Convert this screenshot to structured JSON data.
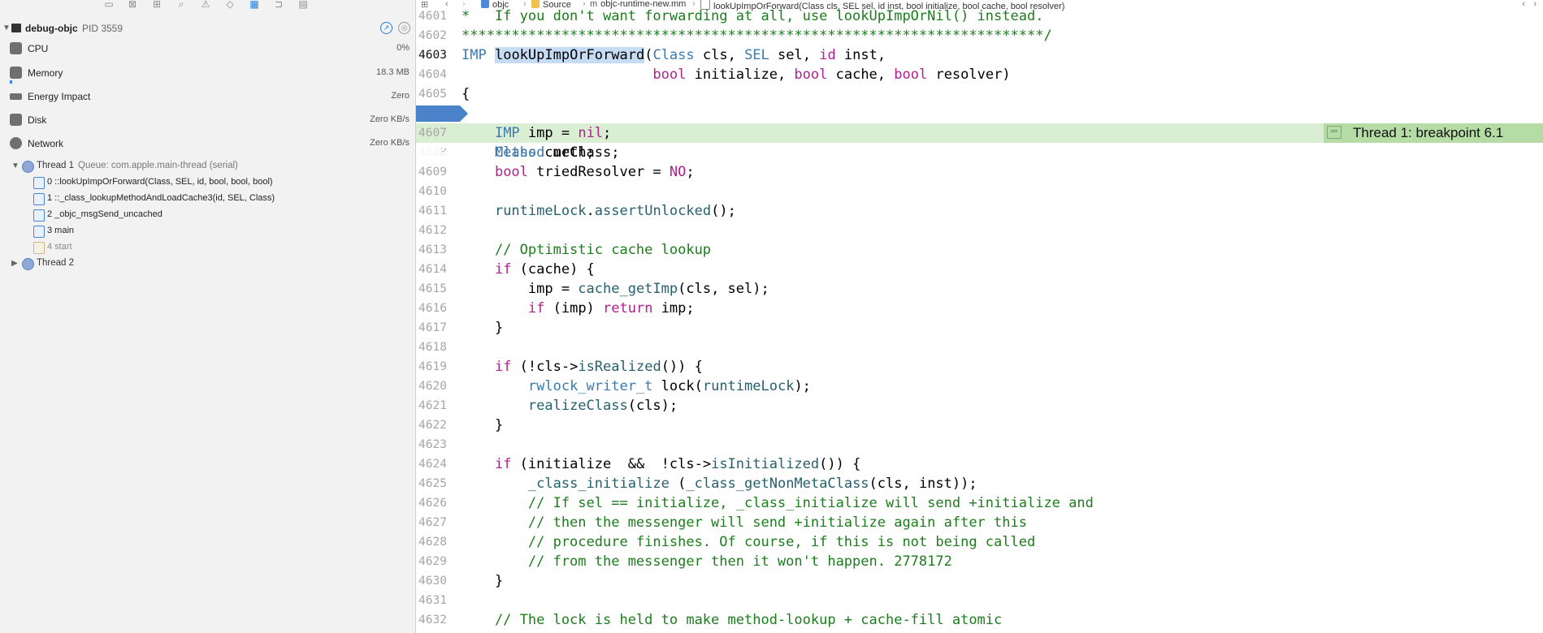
{
  "sidebar": {
    "process": {
      "name": "debug-objc",
      "pid": "PID 3559"
    },
    "gauges": [
      {
        "label": "CPU",
        "value": "0%"
      },
      {
        "label": "Memory",
        "value": "18.3 MB"
      },
      {
        "label": "Energy Impact",
        "value": "Zero"
      },
      {
        "label": "Disk",
        "value": "Zero KB/s"
      },
      {
        "label": "Network",
        "value": "Zero KB/s"
      }
    ],
    "thread1": {
      "label": "Thread 1",
      "queue": "Queue: com.apple.main-thread (serial)"
    },
    "frames": [
      {
        "text": "0 ::lookUpImpOrForward(Class, SEL, id, bool, bool, bool)"
      },
      {
        "text": "1 ::_class_lookupMethodAndLoadCache3(id, SEL, Class)"
      },
      {
        "text": "2 _objc_msgSend_uncached"
      },
      {
        "text": "3 main"
      },
      {
        "text": "4 start"
      }
    ],
    "thread2": {
      "label": "Thread 2"
    }
  },
  "jumpbar": {
    "crumbs": [
      "objc",
      "Source",
      "objc-runtime-new.mm",
      "lookUpImpOrForward(Class cls, SEL sel, id inst, bool initialize, bool cache, bool resolver)"
    ]
  },
  "editor": {
    "breakpoint_note": "Thread 1: breakpoint 6.1",
    "current_line": "4606",
    "line_numbers": [
      "4601",
      "4602",
      "4603",
      "4604",
      "4605",
      "4606",
      "4607",
      "4608",
      "4609",
      "4610",
      "4611",
      "4612",
      "4613",
      "4614",
      "4615",
      "4616",
      "4617",
      "4618",
      "4619",
      "4620",
      "4621",
      "4622",
      "4623",
      "4624",
      "4625",
      "4626",
      "4627",
      "4628",
      "4629",
      "4630",
      "4631",
      "4632"
    ]
  },
  "colors": {
    "keyword": "#b12091",
    "type": "#3a7ab0",
    "comment": "#1c7d1c",
    "breakpoint_line": "#d9eed2",
    "breakpoint_marker": "#4a83c9"
  }
}
